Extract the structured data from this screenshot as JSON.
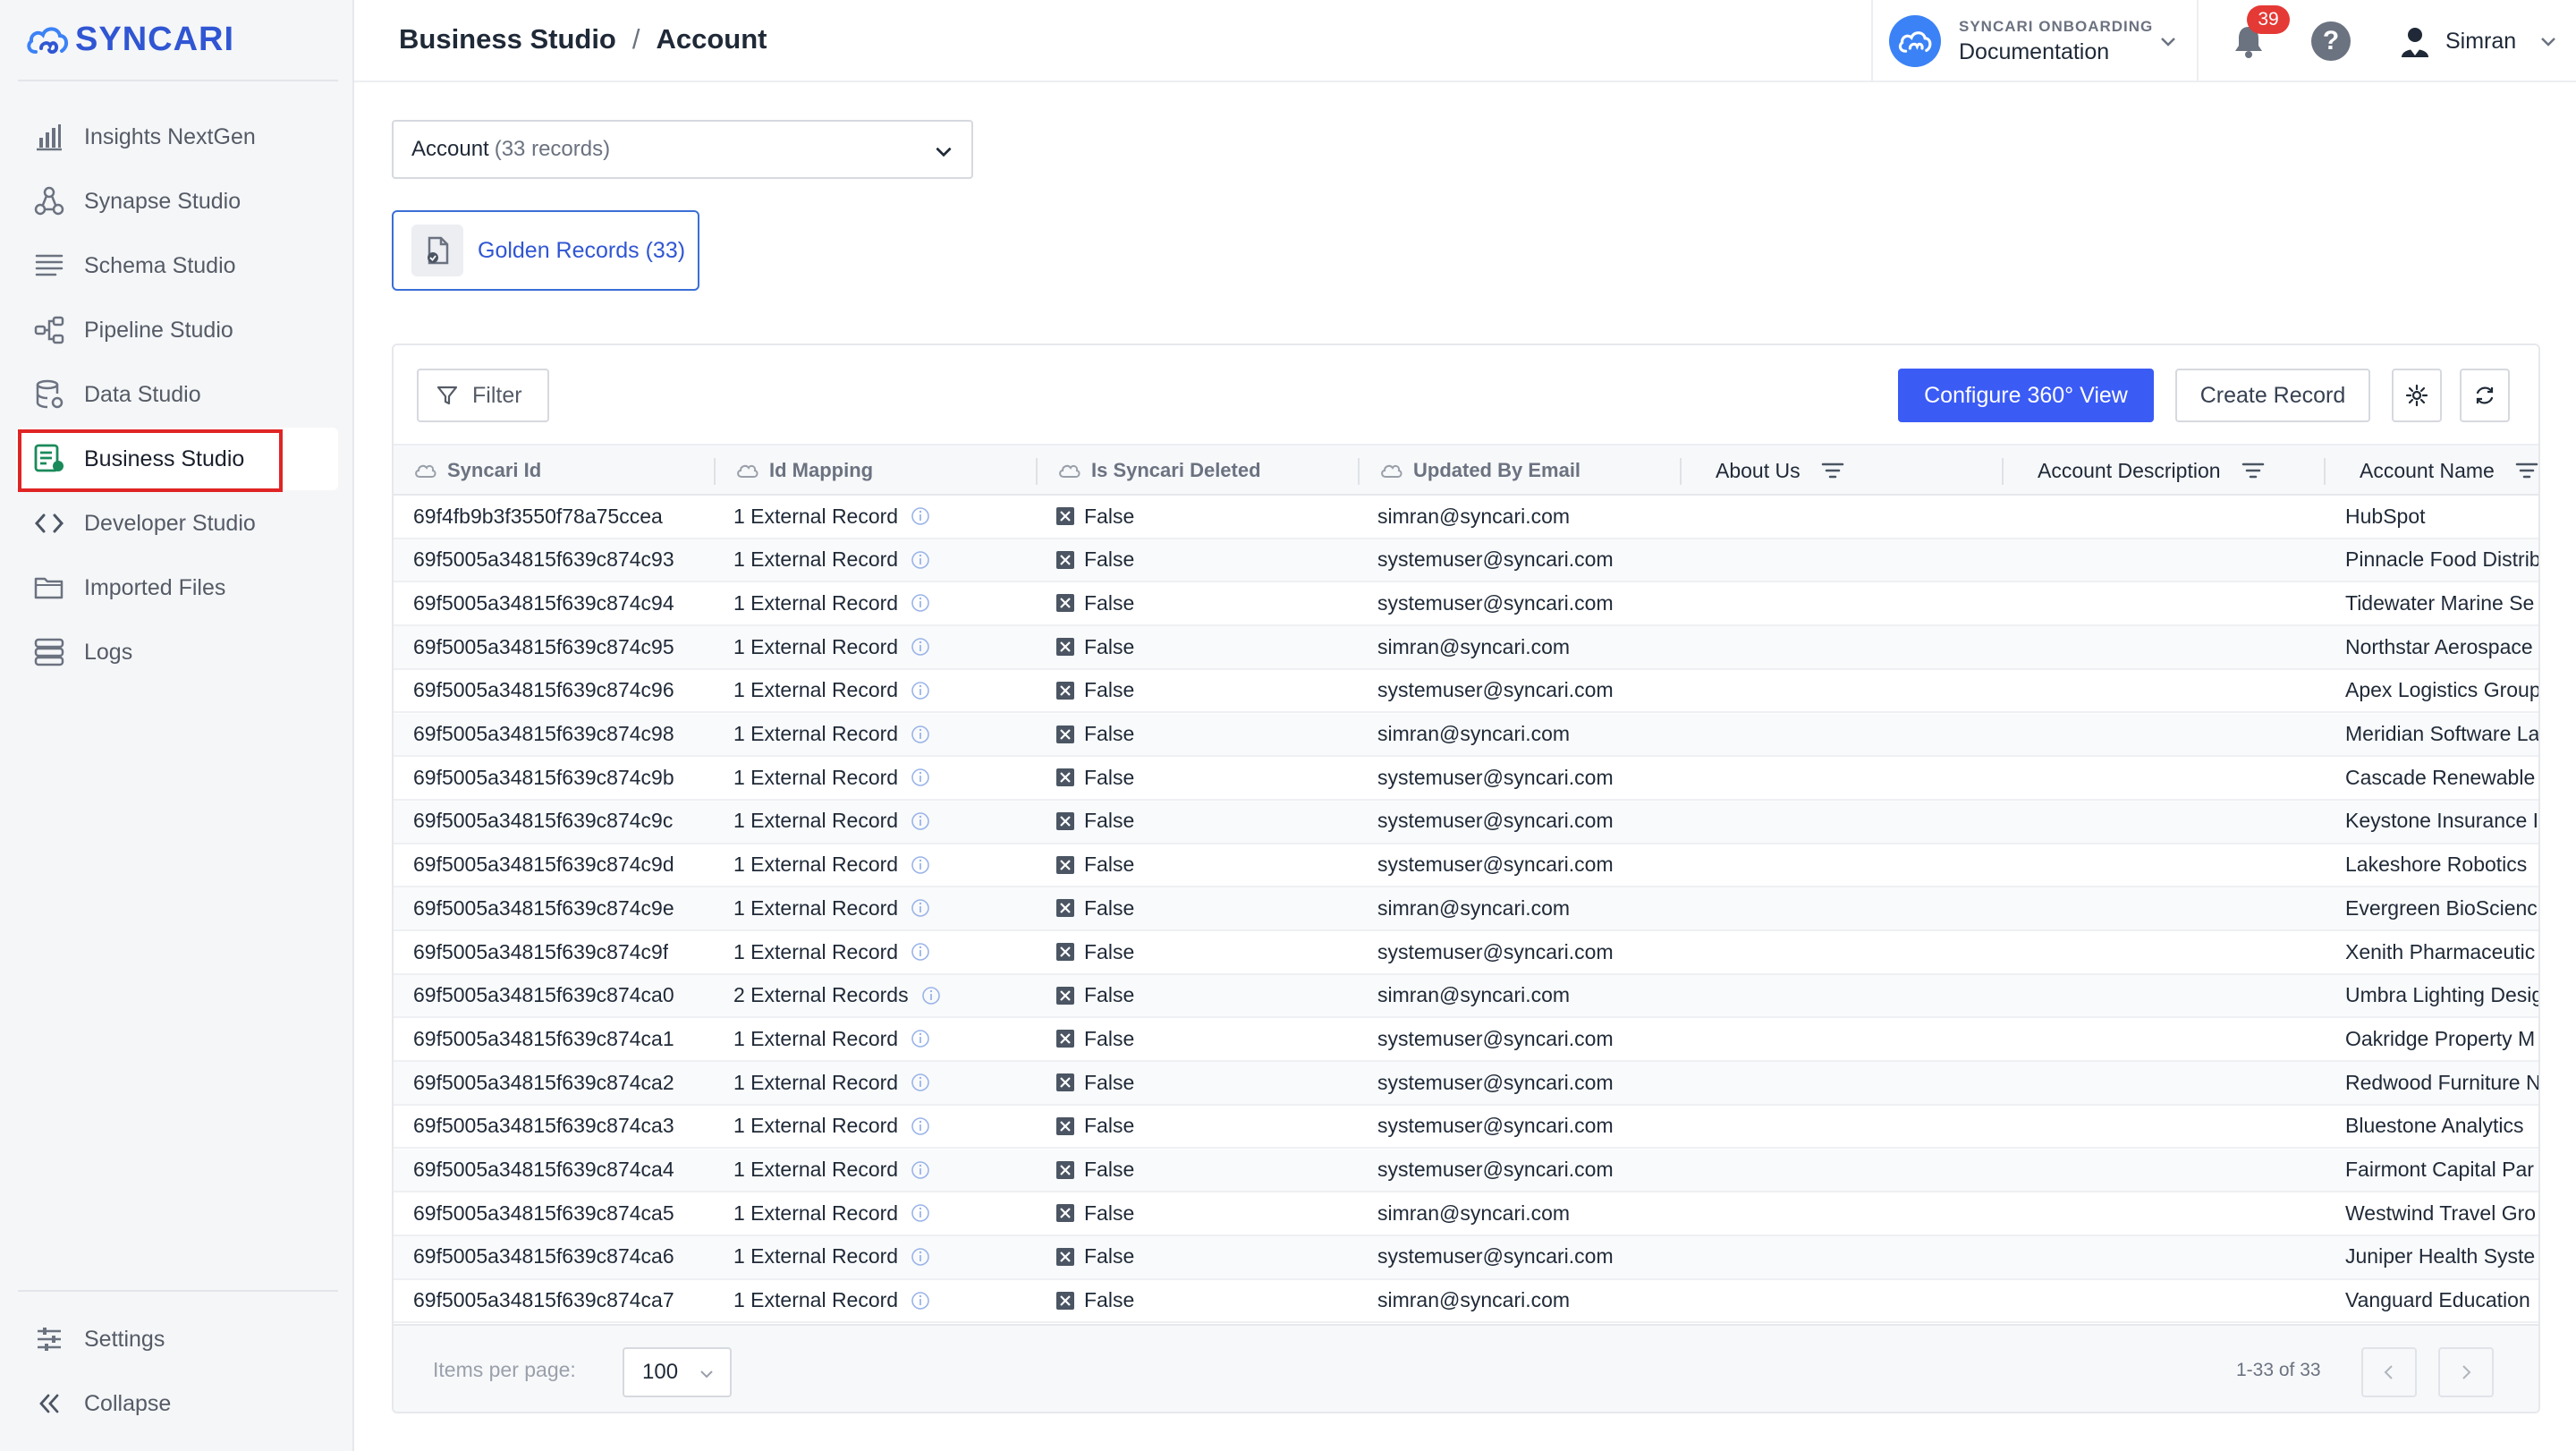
{
  "brand": {
    "name": "SYNCARI"
  },
  "sidebar": {
    "items": [
      {
        "label": "Insights NextGen",
        "icon": "bar-chart-icon"
      },
      {
        "label": "Synapse Studio",
        "icon": "nodes-icon"
      },
      {
        "label": "Schema Studio",
        "icon": "list-icon"
      },
      {
        "label": "Pipeline Studio",
        "icon": "pipeline-icon"
      },
      {
        "label": "Data Studio",
        "icon": "database-icon"
      },
      {
        "label": "Business Studio",
        "icon": "business-icon",
        "active": true
      },
      {
        "label": "Developer Studio",
        "icon": "code-icon"
      },
      {
        "label": "Imported Files",
        "icon": "folder-icon"
      },
      {
        "label": "Logs",
        "icon": "logs-icon"
      }
    ],
    "bottom": [
      {
        "label": "Settings",
        "icon": "sliders-icon"
      },
      {
        "label": "Collapse",
        "icon": "collapse-icon"
      }
    ]
  },
  "header": {
    "breadcrumb": [
      "Business Studio",
      "Account"
    ],
    "org_label": "SYNCARI ONBOARDING",
    "org_name": "Documentation",
    "notifications": "39",
    "help": "?",
    "user": "Simran"
  },
  "object_select": {
    "label": "Account",
    "count": "(33 records)"
  },
  "golden_records": {
    "label": "Golden Records",
    "count": "(33)"
  },
  "toolbar": {
    "filter": "Filter",
    "configure": "Configure 360° View",
    "create": "Create Record"
  },
  "table": {
    "columns": [
      "Syncari Id",
      "Id Mapping",
      "Is Syncari Deleted",
      "Updated By Email",
      "About Us",
      "Account Description",
      "Account Name"
    ],
    "rows": [
      [
        "69f4fb9b3f3550f78a75ccea",
        "1 External Record",
        "False",
        "simran@syncari.com",
        "",
        "",
        "HubSpot"
      ],
      [
        "69f5005a34815f639c874c93",
        "1 External Record",
        "False",
        "systemuser@syncari.com",
        "",
        "",
        "Pinnacle Food Distrib"
      ],
      [
        "69f5005a34815f639c874c94",
        "1 External Record",
        "False",
        "systemuser@syncari.com",
        "",
        "",
        "Tidewater Marine Se"
      ],
      [
        "69f5005a34815f639c874c95",
        "1 External Record",
        "False",
        "simran@syncari.com",
        "",
        "",
        "Northstar Aerospace"
      ],
      [
        "69f5005a34815f639c874c96",
        "1 External Record",
        "False",
        "systemuser@syncari.com",
        "",
        "",
        "Apex Logistics Group"
      ],
      [
        "69f5005a34815f639c874c98",
        "1 External Record",
        "False",
        "simran@syncari.com",
        "",
        "",
        "Meridian Software La"
      ],
      [
        "69f5005a34815f639c874c9b",
        "1 External Record",
        "False",
        "systemuser@syncari.com",
        "",
        "",
        "Cascade Renewable"
      ],
      [
        "69f5005a34815f639c874c9c",
        "1 External Record",
        "False",
        "systemuser@syncari.com",
        "",
        "",
        "Keystone Insurance I"
      ],
      [
        "69f5005a34815f639c874c9d",
        "1 External Record",
        "False",
        "systemuser@syncari.com",
        "",
        "",
        "Lakeshore Robotics"
      ],
      [
        "69f5005a34815f639c874c9e",
        "1 External Record",
        "False",
        "simran@syncari.com",
        "",
        "",
        "Evergreen BioScienc"
      ],
      [
        "69f5005a34815f639c874c9f",
        "1 External Record",
        "False",
        "systemuser@syncari.com",
        "",
        "",
        "Xenith Pharmaceutic"
      ],
      [
        "69f5005a34815f639c874ca0",
        "2 External Records",
        "False",
        "simran@syncari.com",
        "",
        "",
        "Umbra Lighting Desig"
      ],
      [
        "69f5005a34815f639c874ca1",
        "1 External Record",
        "False",
        "systemuser@syncari.com",
        "",
        "",
        "Oakridge Property M"
      ],
      [
        "69f5005a34815f639c874ca2",
        "1 External Record",
        "False",
        "systemuser@syncari.com",
        "",
        "",
        "Redwood Furniture N"
      ],
      [
        "69f5005a34815f639c874ca3",
        "1 External Record",
        "False",
        "systemuser@syncari.com",
        "",
        "",
        "Bluestone Analytics"
      ],
      [
        "69f5005a34815f639c874ca4",
        "1 External Record",
        "False",
        "systemuser@syncari.com",
        "",
        "",
        "Fairmont Capital Par"
      ],
      [
        "69f5005a34815f639c874ca5",
        "1 External Record",
        "False",
        "simran@syncari.com",
        "",
        "",
        "Westwind Travel Gro"
      ],
      [
        "69f5005a34815f639c874ca6",
        "1 External Record",
        "False",
        "systemuser@syncari.com",
        "",
        "",
        "Juniper Health Syste"
      ],
      [
        "69f5005a34815f639c874ca7",
        "1 External Record",
        "False",
        "simran@syncari.com",
        "",
        "",
        "Vanguard Education"
      ]
    ]
  },
  "pagination": {
    "items_per_page_label": "Items per page:",
    "items_per_page": "100",
    "range": "1-33 of 33"
  },
  "colors": {
    "accent": "#3b5bf5",
    "brand": "#3056d3",
    "highlight": "#e02424",
    "badge": "#e53935"
  }
}
